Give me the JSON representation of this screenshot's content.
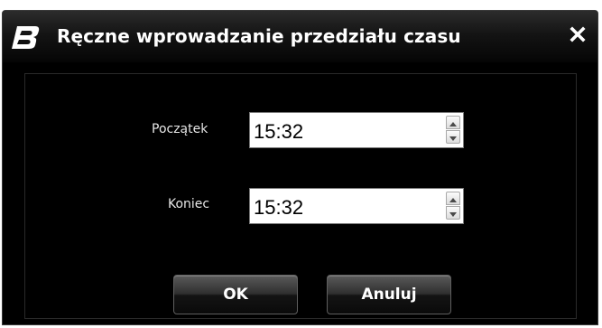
{
  "window": {
    "title": "Ręczne wprowadzanie przedziału czasu",
    "logo_icon": "b-logo-icon",
    "close_icon": "close-icon",
    "close_glyph": "✕"
  },
  "form": {
    "start": {
      "label": "Początek",
      "value": "15:32"
    },
    "end": {
      "label": "Koniec",
      "value": "15:32"
    }
  },
  "buttons": {
    "ok_label": "OK",
    "cancel_label": "Anuluj"
  },
  "colors": {
    "background": "#000000",
    "text": "#ffffff",
    "input_background": "#ffffff"
  }
}
